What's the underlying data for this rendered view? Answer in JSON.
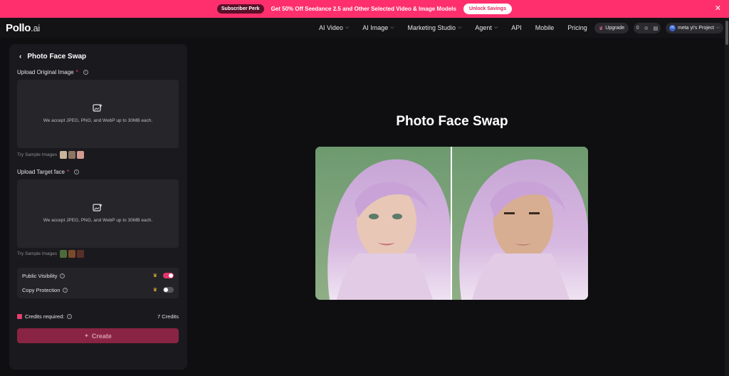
{
  "promo": {
    "badge": "Subscriber Perk",
    "message": "Get 50% Off Seedance 2.5 and Other Selected Video & Image Models",
    "cta": "Unlock Savings",
    "close": "✕"
  },
  "nav": {
    "logo_main": "Pollo",
    "logo_suffix": ".ai",
    "items": [
      {
        "label": "AI Video",
        "has_dropdown": true
      },
      {
        "label": "AI Image",
        "has_dropdown": true
      },
      {
        "label": "Marketing Studio",
        "has_dropdown": true
      },
      {
        "label": "Agent",
        "has_dropdown": true
      },
      {
        "label": "API",
        "has_dropdown": false
      },
      {
        "label": "Mobile",
        "has_dropdown": false
      },
      {
        "label": "Pricing",
        "has_dropdown": false
      }
    ],
    "upgrade": "Upgrade",
    "credits": "0",
    "project_avatar": "m",
    "project": "meta yi's Project"
  },
  "panel": {
    "title": "Photo Face Swap",
    "original": {
      "label": "Upload Original Image",
      "required": "*",
      "hint": "We accept JPEG, PNG, and WebP up to 30MB each.",
      "samples_label": "Try Sample Images"
    },
    "target": {
      "label": "Upload Target face",
      "required": "*",
      "hint": "We accept JPEG, PNG, and WebP up to 30MB each.",
      "samples_label": "Try Sample Images"
    },
    "settings": {
      "public_visibility": {
        "label": "Public Visibility",
        "enabled": true
      },
      "copy_protection": {
        "label": "Copy Protection",
        "enabled": false
      }
    },
    "credits_label": "Credits required:",
    "credits_value": "7 Credits",
    "create": "Create"
  },
  "main": {
    "title": "Photo Face Swap"
  },
  "colors": {
    "accent": "#ff2f6d",
    "background": "#0f0f11",
    "panel": "#1a1a1e",
    "create_button": "#8a2444"
  }
}
